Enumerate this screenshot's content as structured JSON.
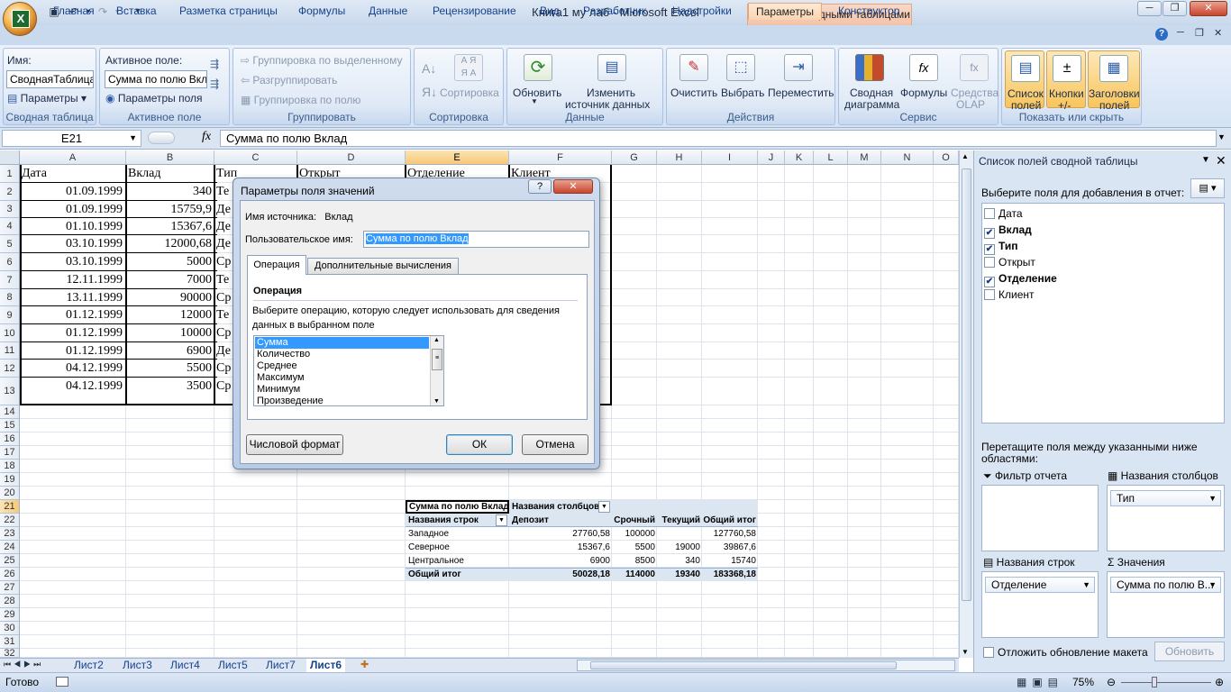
{
  "window": {
    "title": "Книга1 му лаб - Microsoft Excel",
    "context_tab": "Работа со сводными таблицами",
    "min": "─",
    "max": "❐",
    "close": "✕"
  },
  "tabs": [
    "Главная",
    "Вставка",
    "Разметка страницы",
    "Формулы",
    "Данные",
    "Рецензирование",
    "Вид",
    "Разработчик",
    "Надстройки",
    "Параметры",
    "Конструктор"
  ],
  "ribbon": {
    "pivot": {
      "name_label": "Имя:",
      "name_value": "СводнаяТаблица1",
      "params": "Параметры",
      "label": "Сводная таблица"
    },
    "field": {
      "active_label": "Активное поле:",
      "active_value": "Сумма по полю Вклад",
      "params": "Параметры поля",
      "label": "Активное поле"
    },
    "group": {
      "by_sel": "Группировка по выделенному",
      "ungroup": "Разгруппировать",
      "by_field": "Группировка по полю",
      "label": "Группировать"
    },
    "sort": {
      "sort": "Сортировка",
      "label": "Сортировка"
    },
    "data": {
      "refresh": "Обновить",
      "change1": "Изменить",
      "change2": "источник данных",
      "label": "Данные"
    },
    "actions": {
      "clear": "Очистить",
      "select": "Выбрать",
      "move": "Переместить",
      "label": "Действия"
    },
    "service": {
      "chart1": "Сводная",
      "chart2": "диаграмма",
      "formulas": "Формулы",
      "olap1": "Средства",
      "olap2": "OLAP",
      "label": "Сервис"
    },
    "show": {
      "list1": "Список",
      "list2": "полей",
      "btn1": "Кнопки",
      "btn2": "+/-",
      "hdr1": "Заголовки",
      "hdr2": "полей",
      "label": "Показать или скрыть"
    }
  },
  "formula_bar": {
    "cell": "E21",
    "fx": "fx",
    "content": "Сумма по полю Вклад"
  },
  "columns": [
    "A",
    "B",
    "C",
    "D",
    "E",
    "F",
    "G",
    "H",
    "I",
    "J",
    "K",
    "L",
    "M",
    "N",
    "O"
  ],
  "rows": [
    "1",
    "2",
    "3",
    "4",
    "5",
    "6",
    "7",
    "8",
    "9",
    "10",
    "11",
    "12",
    "13",
    "14",
    "15",
    "16",
    "17",
    "18",
    "19",
    "20",
    "21",
    "22",
    "23",
    "24",
    "25",
    "26",
    "27",
    "28",
    "29",
    "30",
    "31",
    "32"
  ],
  "table": {
    "headers": [
      "Дата",
      "Вклад",
      "Тип",
      "Открыт",
      "Отделение",
      "Клиент"
    ],
    "dates": [
      "01.09.1999",
      "01.09.1999",
      "01.10.1999",
      "03.10.1999",
      "03.10.1999",
      "12.11.1999",
      "13.11.1999",
      "01.12.1999",
      "01.12.1999",
      "01.12.1999",
      "04.12.1999",
      "04.12.1999"
    ],
    "amounts": [
      "340",
      "15759,9",
      "15367,6",
      "12000,68",
      "5000",
      "7000",
      "90000",
      "12000",
      "10000",
      "6900",
      "5500",
      "3500"
    ],
    "types": [
      "Те",
      "Де",
      "Де",
      "Де",
      "Ср",
      "Те",
      "Ср",
      "Те",
      "Ср",
      "Де",
      "Ср",
      "Ср"
    ]
  },
  "pivot": {
    "corner": "Сумма по полю Вклад",
    "col_hdr": "Названия столбцов",
    "row_hdr": "Названия строк",
    "cols": [
      "Депозит",
      "Срочный",
      "Текущий",
      "Общий итог"
    ],
    "rows": [
      {
        "name": "Западное",
        "v": [
          "27760,58",
          "100000",
          "",
          "127760,58"
        ]
      },
      {
        "name": "Северное",
        "v": [
          "15367,6",
          "5500",
          "19000",
          "39867,6"
        ]
      },
      {
        "name": "Центральное",
        "v": [
          "6900",
          "8500",
          "340",
          "15740"
        ]
      }
    ],
    "total": {
      "name": "Общий итог",
      "v": [
        "50028,18",
        "114000",
        "19340",
        "183368,18"
      ]
    }
  },
  "sheets": [
    "Лист2",
    "Лист3",
    "Лист4",
    "Лист5",
    "Лист7",
    "Лист6"
  ],
  "status": {
    "ready": "Готово",
    "zoom": "75%"
  },
  "pane": {
    "title": "Список полей сводной таблицы",
    "choose": "Выберите поля для добавления в отчет:",
    "fields": [
      {
        "name": "Дата",
        "checked": false
      },
      {
        "name": "Вклад",
        "checked": true
      },
      {
        "name": "Тип",
        "checked": true
      },
      {
        "name": "Открыт",
        "checked": false
      },
      {
        "name": "Отделение",
        "checked": true
      },
      {
        "name": "Клиент",
        "checked": false
      }
    ],
    "drag": "Перетащите поля между указанными ниже областями:",
    "filter": "Фильтр отчета",
    "columns": "Названия столбцов",
    "rows": "Названия строк",
    "values": "Значения",
    "col_field": "Тип",
    "row_field": "Отделение",
    "val_field": "Сумма по полю В...",
    "defer": "Отложить обновление макета",
    "update": "Обновить"
  },
  "dialog": {
    "title": "Параметры поля значений",
    "source_label": "Имя источника:",
    "source_value": "Вклад",
    "custom_label": "Пользовательское имя:",
    "custom_value": "Сумма по полю Вклад",
    "tab1": "Операция",
    "tab2": "Дополнительные вычисления",
    "section": "Операция",
    "desc": "Выберите операцию, которую следует использовать для сведения данных в выбранном поле",
    "ops": [
      "Сумма",
      "Количество",
      "Среднее",
      "Максимум",
      "Минимум",
      "Произведение"
    ],
    "number_format": "Числовой формат",
    "ok": "ОК",
    "cancel": "Отмена",
    "help": "?"
  }
}
